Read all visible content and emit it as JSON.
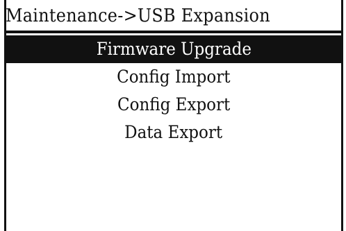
{
  "header": {
    "title": "Maintenance->USB Expansion"
  },
  "menu": {
    "selected_index": 0,
    "items": [
      {
        "label": "Firmware Upgrade"
      },
      {
        "label": "Config Import"
      },
      {
        "label": "Config Export"
      },
      {
        "label": "Data Export"
      }
    ]
  },
  "colors": {
    "background": "#ffffff",
    "foreground": "#111111",
    "highlight_background": "#111111",
    "highlight_text": "#ffffff"
  }
}
